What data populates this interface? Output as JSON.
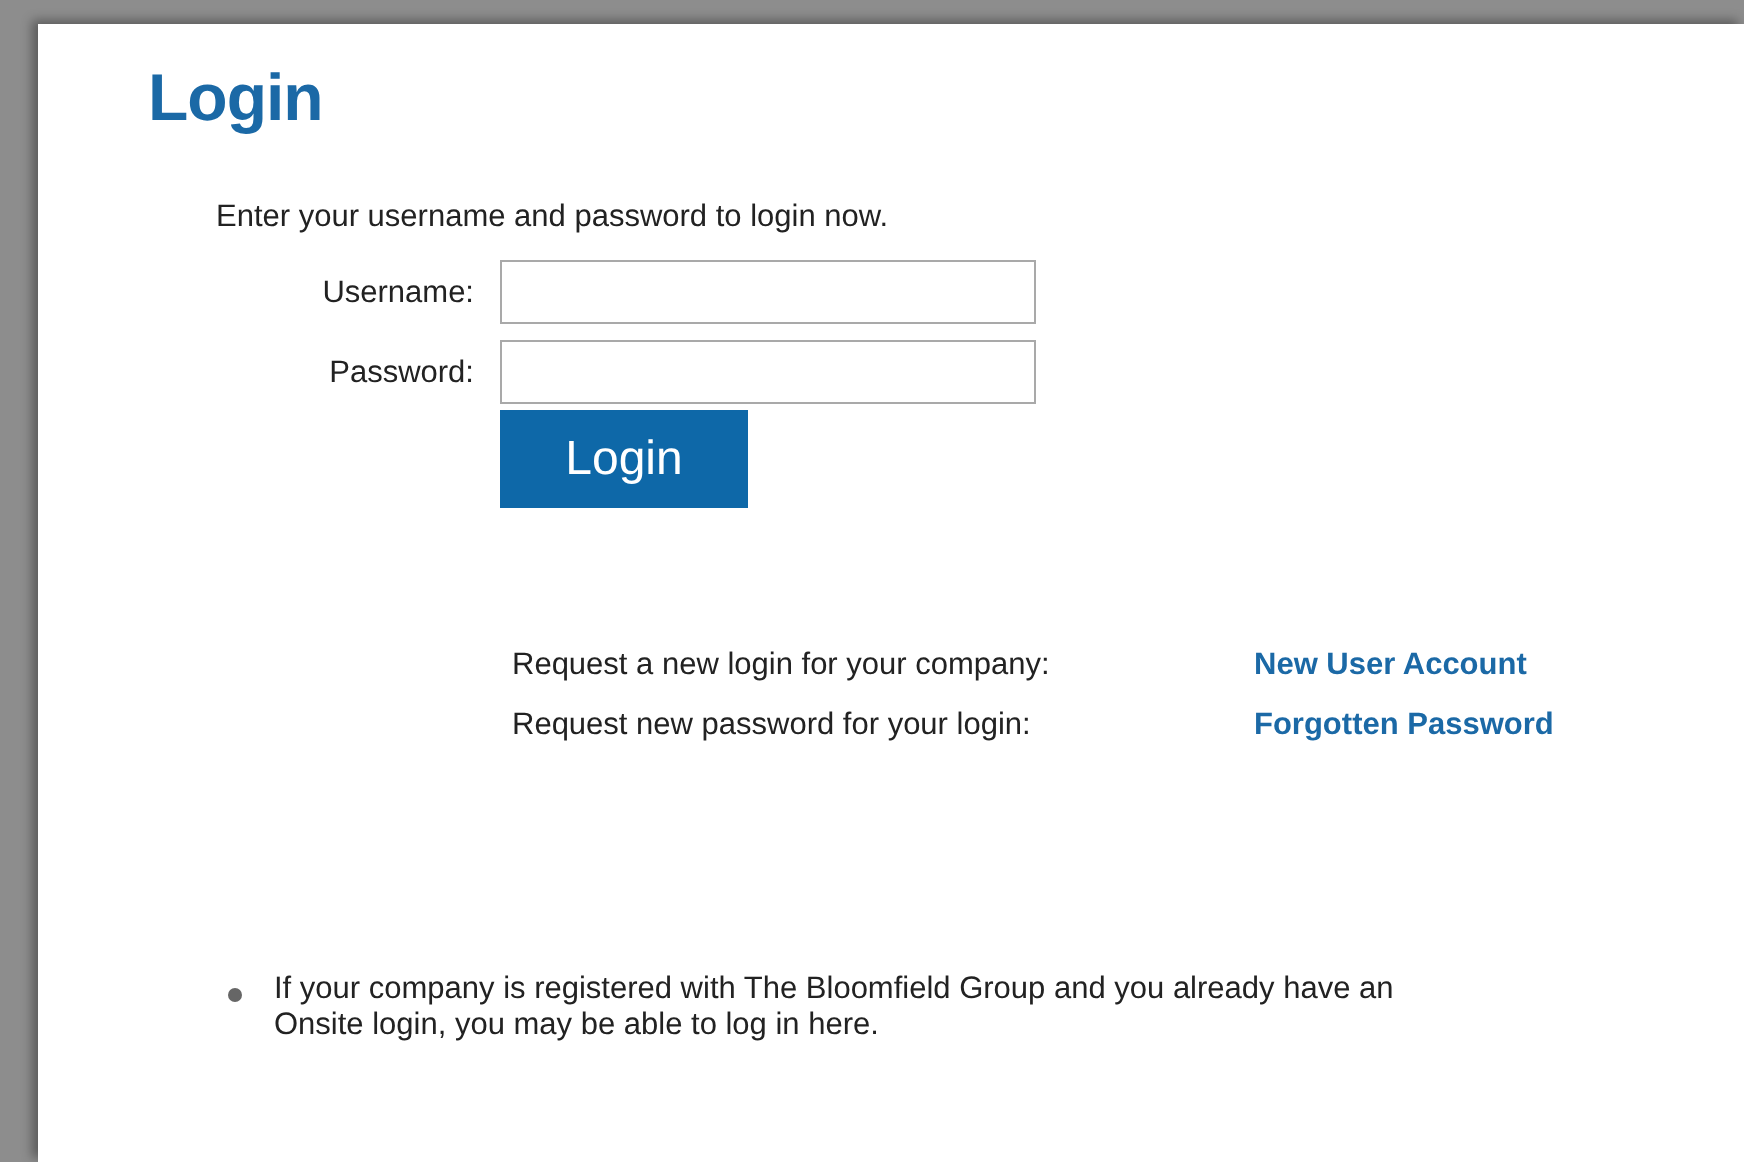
{
  "title": "Login",
  "intro": "Enter your username and password to login now.",
  "fields": [
    {
      "label": "Username:"
    },
    {
      "label": "Password:"
    }
  ],
  "button": "Login",
  "requests": [
    {
      "text": "Request a new login for your company:",
      "link": "New User Account"
    },
    {
      "text": "Request new password for your login:",
      "link": "Forgotten Password"
    }
  ],
  "notes": [
    "If your company is registered with The Bloomfield Group and you already have an Onsite login, you may be able to log in here."
  ]
}
